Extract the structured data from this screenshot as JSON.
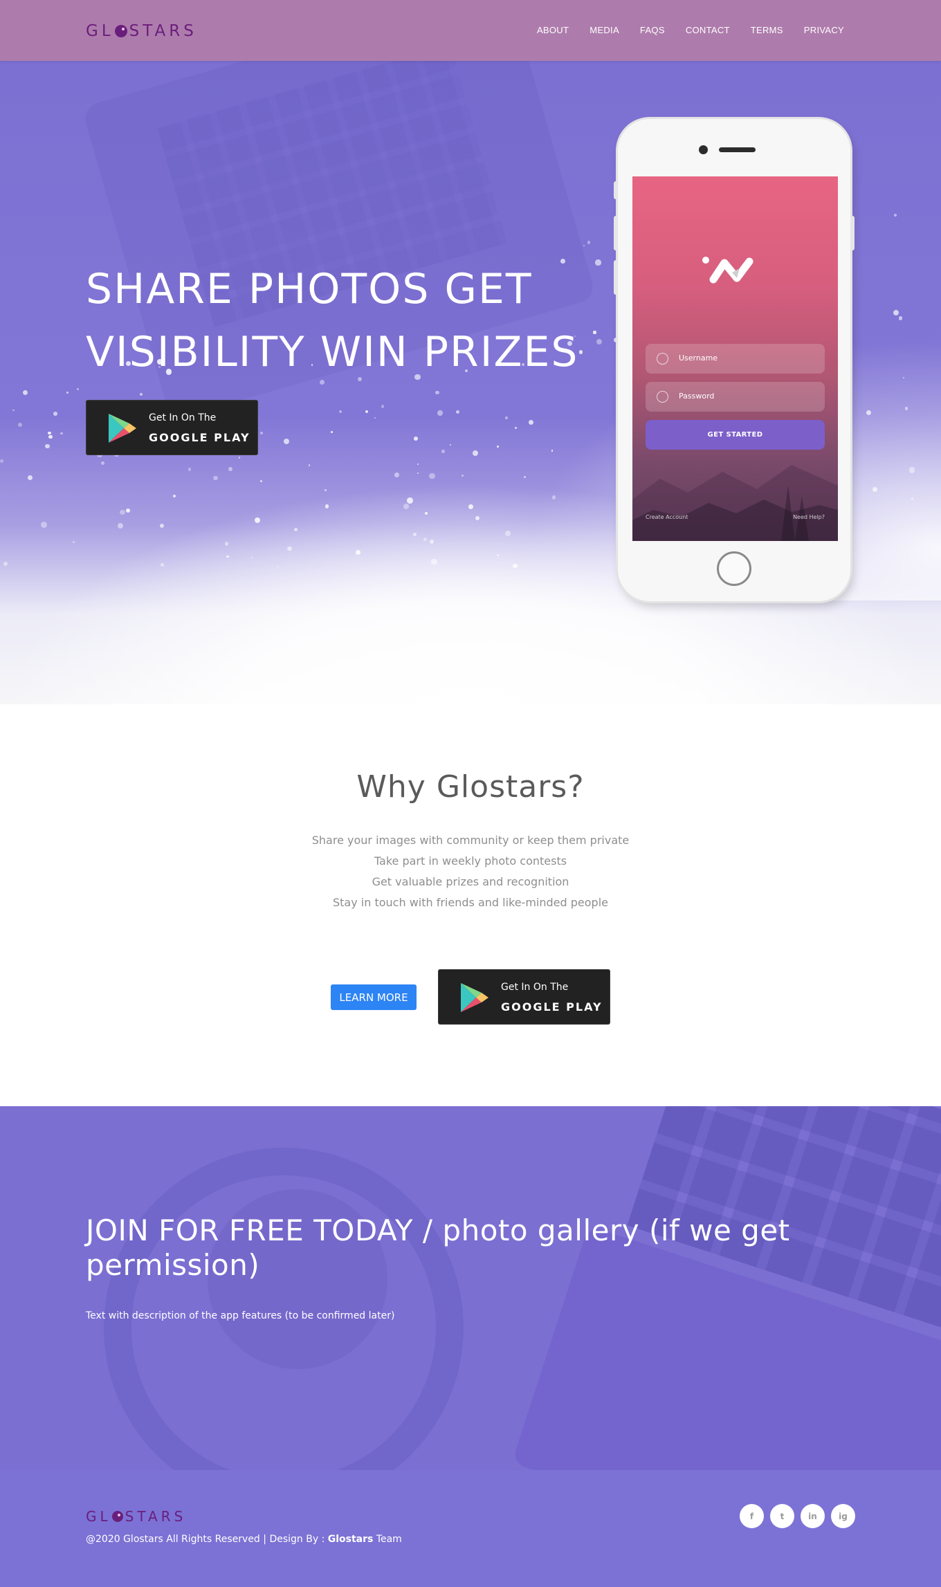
{
  "brand": {
    "logo_left": "GL",
    "logo_right": "STARS",
    "accent": "#6a1e7c"
  },
  "nav": {
    "items": [
      "ABOUT",
      "MEDIA",
      "FAQS",
      "CONTACT",
      "TERMS",
      "PRIVACY"
    ],
    "bg": "#ae7cac"
  },
  "hero": {
    "title_line1": "SHARE PHOTOS GET",
    "title_line2": "VISIBILITY WIN PRIZES",
    "store": {
      "small": "Get In On The",
      "big": "GOOGLE PLAY"
    },
    "phone": {
      "username_placeholder": "Username",
      "password_placeholder": "Password",
      "button": "GET STARTED",
      "create_account": "Create Account",
      "need_help": "Need Help?"
    }
  },
  "why": {
    "title": "Why Glostars?",
    "features": [
      "Share your images with community or keep them private",
      "Take part in weekly photo contests",
      "Get valuable prizes and recognition",
      "Stay in touch with friends and like-minded people"
    ],
    "learn_more": "LEARN MORE",
    "store": {
      "small": "Get In On The",
      "big": "GOOGLE PLAY"
    }
  },
  "join": {
    "title": "JOIN FOR FREE TODAY / photo gallery (if we get permission)",
    "description": "Text with description of the app features (to be confirmed later)"
  },
  "footer": {
    "copyright_prefix": "@2020 Glostars All Rights Reserved | Design By : ",
    "copyright_brand": "Glostars",
    "copyright_suffix": " Team",
    "socials": [
      "facebook-icon",
      "twitter-icon",
      "linkedin-icon",
      "instagram-icon"
    ],
    "social_glyphs": [
      "f",
      "t",
      "in",
      "ig"
    ]
  },
  "colors": {
    "primary": "#7c72d5",
    "button_blue": "#2d84f4",
    "dark": "#222222"
  }
}
